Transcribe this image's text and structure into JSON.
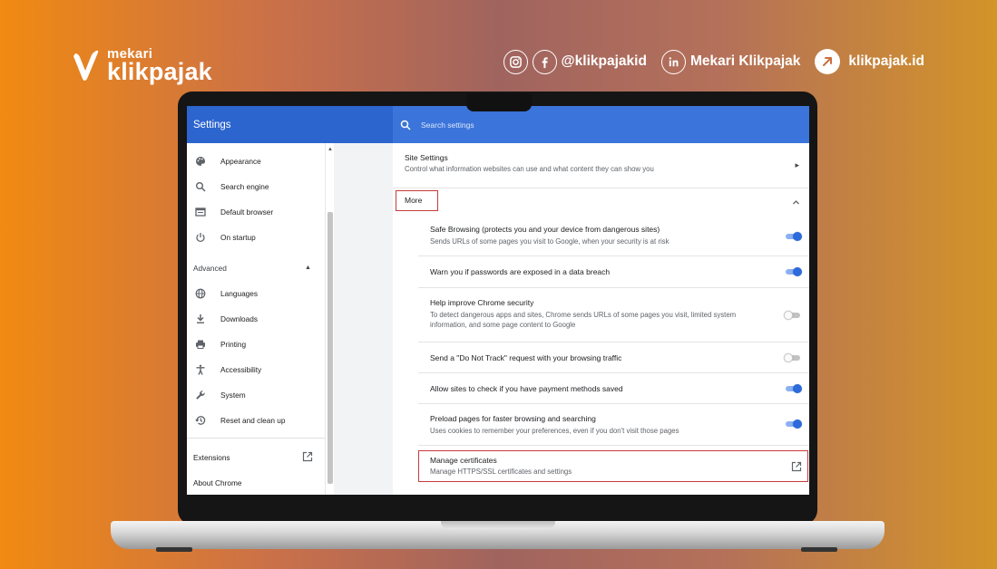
{
  "banner": {
    "brand_small": "mekari",
    "brand_big": "klikpajak",
    "social_handle": "@klikpajakid",
    "linkedin_name": "Mekari Klikpajak",
    "website": "klikpajak.id"
  },
  "settings": {
    "title": "Settings",
    "search_placeholder": "Search settings",
    "sidebar": {
      "items": [
        {
          "label": "Appearance",
          "icon": "palette-icon"
        },
        {
          "label": "Search engine",
          "icon": "search-icon"
        },
        {
          "label": "Default browser",
          "icon": "browser-icon"
        },
        {
          "label": "On startup",
          "icon": "power-icon"
        }
      ],
      "advanced_label": "Advanced",
      "advanced_items": [
        {
          "label": "Languages",
          "icon": "globe-icon"
        },
        {
          "label": "Downloads",
          "icon": "download-icon"
        },
        {
          "label": "Printing",
          "icon": "printer-icon"
        },
        {
          "label": "Accessibility",
          "icon": "accessibility-icon"
        },
        {
          "label": "System",
          "icon": "wrench-icon"
        },
        {
          "label": "Reset and clean up",
          "icon": "history-icon"
        }
      ],
      "extensions_label": "Extensions",
      "about_label": "About Chrome"
    },
    "content": {
      "site_settings_title": "Site Settings",
      "site_settings_sub": "Control what information websites can use and what content they can show you",
      "more_label": "More",
      "rows": [
        {
          "title": "Safe Browsing (protects you and your device from dangerous sites)",
          "sub": "Sends URLs of some pages you visit to Google, when your security is at risk",
          "enabled": true
        },
        {
          "title": "Warn you if passwords are exposed in a data breach",
          "sub": "",
          "enabled": true
        },
        {
          "title": "Help improve Chrome security",
          "sub": "To detect dangerous apps and sites, Chrome sends URLs of some pages you visit, limited system information, and some page content to Google",
          "enabled": false
        },
        {
          "title": "Send a \"Do Not Track\" request with your browsing traffic",
          "sub": "",
          "enabled": false
        },
        {
          "title": "Allow sites to check if you have payment methods saved",
          "sub": "",
          "enabled": true
        },
        {
          "title": "Preload pages for faster browsing and searching",
          "sub": "Uses cookies to remember your preferences, even if you don't visit those pages",
          "enabled": true
        }
      ],
      "manage_cert_title": "Manage certificates",
      "manage_cert_sub": "Manage HTTPS/SSL certificates and settings"
    }
  },
  "colors": {
    "chrome_blue": "#2d65cf",
    "toggle_on": "#2d6bdc",
    "highlight_red": "#c63a3a"
  }
}
